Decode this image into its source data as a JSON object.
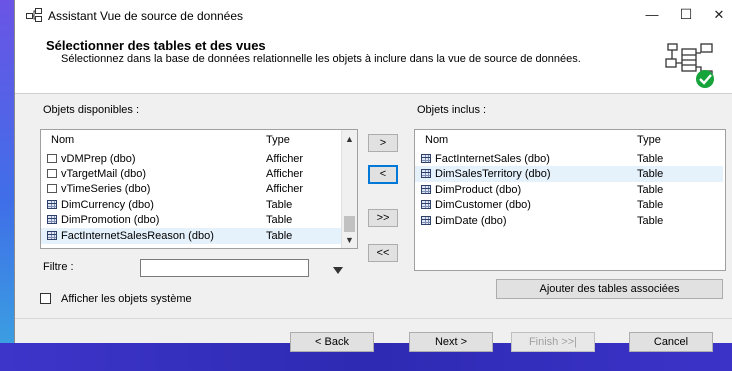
{
  "window": {
    "title": "Assistant Vue de source de données",
    "controls": {
      "minimize": "—",
      "maximize": "☐",
      "close": "✕"
    }
  },
  "header": {
    "title": "Sélectionner des tables et des vues",
    "subtitle": "Sélectionnez dans la base de données relationnelle les objets à inclure dans la vue de source de données.",
    "logo_icon": "data-source-check-icon",
    "check_color": "#15a33a"
  },
  "available": {
    "label": "Objets disponibles :",
    "col_name": "Nom",
    "col_type": "Type",
    "items": [
      {
        "name": "vDMPrep (dbo)",
        "type": "Afficher",
        "icon": "view-icon"
      },
      {
        "name": "vTargetMail (dbo)",
        "type": "Afficher",
        "icon": "view-icon"
      },
      {
        "name": "vTimeSeries (dbo)",
        "type": "Afficher",
        "icon": "view-icon"
      },
      {
        "name": "DimCurrency (dbo)",
        "type": "Table",
        "icon": "table-icon"
      },
      {
        "name": "DimPromotion (dbo)",
        "type": "Table",
        "icon": "table-icon"
      },
      {
        "name": "FactInternetSalesReason (dbo)",
        "type": "Table",
        "icon": "table-icon",
        "selected": true
      }
    ]
  },
  "transfer": {
    "add": ">",
    "remove": "<",
    "add_all": ">>",
    "remove_all": "<<"
  },
  "included": {
    "label": "Objets inclus :",
    "col_name": "Nom",
    "col_type": "Type",
    "items": [
      {
        "name": "FactInternetSales (dbo)",
        "type": "Table",
        "icon": "table-icon"
      },
      {
        "name": "DimSalesTerritory (dbo)",
        "type": "Table",
        "icon": "table-icon",
        "selected": true
      },
      {
        "name": "DimProduct (dbo)",
        "type": "Table",
        "icon": "table-icon"
      },
      {
        "name": "DimCustomer (dbo)",
        "type": "Table",
        "icon": "table-icon"
      },
      {
        "name": "DimDate (dbo)",
        "type": "Table",
        "icon": "table-icon"
      }
    ]
  },
  "filter": {
    "label": "Filtre :",
    "value": "",
    "icon": "filter-icon"
  },
  "add_related_button": "Ajouter des tables associées",
  "show_system_objects": {
    "label": "Afficher les objets système",
    "checked": false
  },
  "footer": {
    "back": "< Back",
    "next": "Next >",
    "finish": "Finish >>|",
    "cancel": "Cancel"
  }
}
